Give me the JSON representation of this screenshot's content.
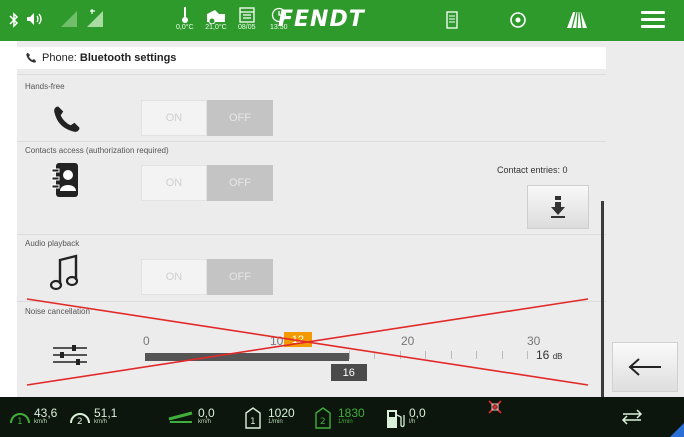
{
  "status_bar": {
    "brand": "FENDT",
    "outside_temp": "0,0°C",
    "cabin_temp": "21,0°C",
    "date": "08/05",
    "time": "13:50"
  },
  "panel": {
    "header_prefix": "Phone:",
    "header_title": "Bluetooth settings"
  },
  "sections": {
    "handsfree": {
      "label": "Hands-free",
      "on": "ON",
      "off": "OFF"
    },
    "contacts": {
      "label": "Contacts access (authorization required)",
      "on": "ON",
      "off": "OFF",
      "entries_label": "Contact entries: 0"
    },
    "audio": {
      "label": "Audio playback",
      "on": "ON",
      "off": "OFF"
    },
    "noise": {
      "label": "Noise cancellation",
      "min": "0",
      "t10": "10",
      "t20": "20",
      "max": "30",
      "previous_value": 12,
      "current_value": 16,
      "readout": "16",
      "unit": "dB",
      "disabled": true
    }
  },
  "bottom_bar": {
    "speed1": {
      "value": "43,6",
      "unit": "km/h"
    },
    "speed2": {
      "value": "51,1",
      "unit": "km/h"
    },
    "speed3": {
      "value": "0,0",
      "unit": "km/h"
    },
    "rpm1": {
      "value": "1020",
      "unit": "1/min"
    },
    "rpm2": {
      "value": "1830",
      "unit": "1/min"
    },
    "fuel": {
      "value": "0,0",
      "unit": "l/h"
    }
  },
  "colors": {
    "brand_green": "#2f9a2c",
    "slider_badge": "#f39a00",
    "cross_red": "#e22a2a"
  }
}
